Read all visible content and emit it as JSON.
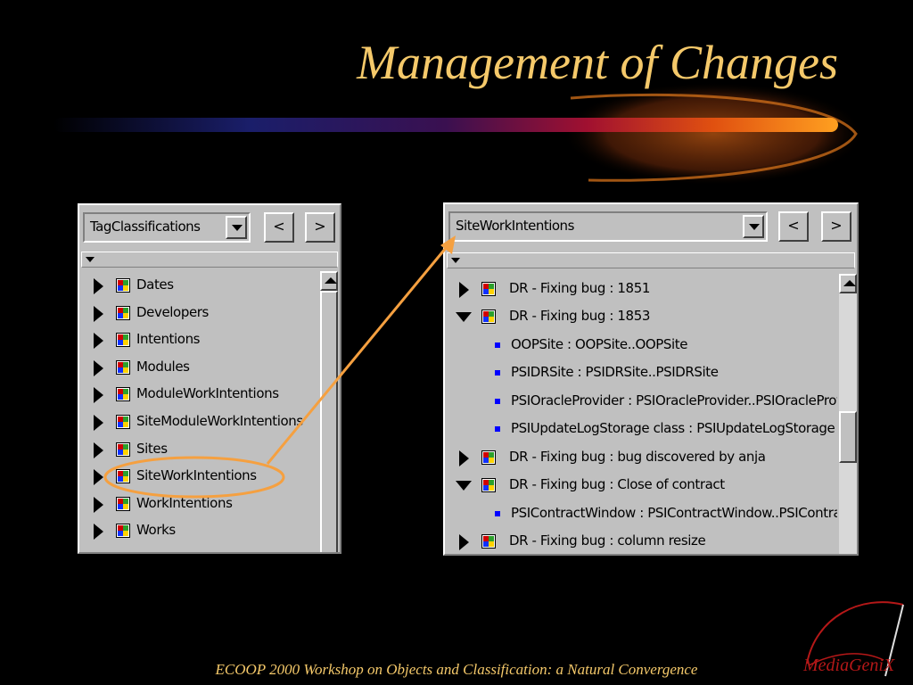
{
  "slide": {
    "title": "Management of Changes",
    "footer": "ECOOP 2000 Workshop on Objects and Classification: a Natural Convergence",
    "logo_text": "MediaGeniX",
    "title_color": "#f5c96a",
    "accent_color": "#f5a040"
  },
  "left_panel": {
    "combo_value": "TagClassifications",
    "prev_label": "<",
    "next_label": ">",
    "items": [
      {
        "label": "Dates",
        "expander": "collapsed",
        "icon": "class-icon"
      },
      {
        "label": "Developers",
        "expander": "collapsed",
        "icon": "class-icon"
      },
      {
        "label": "Intentions",
        "expander": "collapsed",
        "icon": "class-icon"
      },
      {
        "label": "Modules",
        "expander": "collapsed",
        "icon": "class-icon"
      },
      {
        "label": "ModuleWorkIntentions",
        "expander": "collapsed",
        "icon": "class-icon"
      },
      {
        "label": "SiteModuleWorkIntentions",
        "expander": "collapsed",
        "icon": "class-icon"
      },
      {
        "label": "Sites",
        "expander": "collapsed",
        "icon": "class-icon"
      },
      {
        "label": "SiteWorkIntentions",
        "expander": "collapsed",
        "icon": "class-icon",
        "highlighted": true
      },
      {
        "label": "WorkIntentions",
        "expander": "collapsed",
        "icon": "class-icon"
      },
      {
        "label": "Works",
        "expander": "collapsed",
        "icon": "class-icon"
      }
    ]
  },
  "right_panel": {
    "combo_value": "SiteWorkIntentions",
    "prev_label": "<",
    "next_label": ">",
    "items": [
      {
        "label": "DR - Fixing bug :  1851",
        "kind": "node",
        "expander": "collapsed"
      },
      {
        "label": "DR - Fixing bug :  1853",
        "kind": "node",
        "expander": "expanded"
      },
      {
        "label": "OOPSite : OOPSite..OOPSite",
        "kind": "leaf"
      },
      {
        "label": "PSIDRSite : PSIDRSite..PSIDRSite",
        "kind": "leaf"
      },
      {
        "label": "PSIOracleProvider : PSIOracleProvider..PSIOracleProvider",
        "kind": "leaf"
      },
      {
        "label": "PSIUpdateLogStorage class : PSIUpdateLogStorage",
        "kind": "leaf"
      },
      {
        "label": "DR - Fixing bug :  bug discovered by anja",
        "kind": "node",
        "expander": "collapsed"
      },
      {
        "label": "DR - Fixing bug :  Close of contract",
        "kind": "node",
        "expander": "expanded"
      },
      {
        "label": "PSIContractWindow : PSIContractWindow..PSIContractWindow",
        "kind": "leaf"
      },
      {
        "label": "DR - Fixing bug :  column resize",
        "kind": "node",
        "expander": "collapsed"
      }
    ]
  }
}
